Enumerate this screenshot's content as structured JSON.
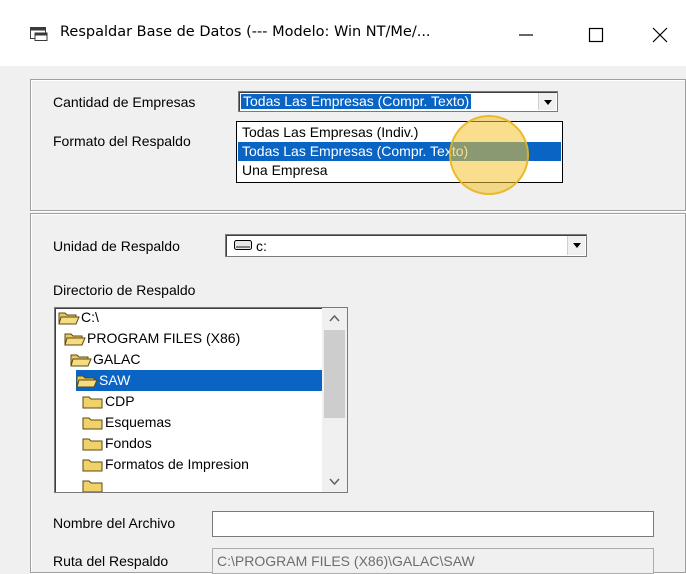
{
  "window": {
    "title": "Respaldar Base de Datos  (--- Modelo: Win NT/Me/...",
    "icon": "window-app-icon",
    "controls": [
      "minimize-icon",
      "maximize-icon",
      "close-icon"
    ]
  },
  "options_group": {
    "cantidad_label": "Cantidad de Empresas",
    "cantidad_value": "Todas Las Empresas (Compr. Texto)",
    "formato_label": "Formato del Respaldo",
    "dropdown_options": [
      "Todas Las Empresas (Indiv.)",
      "Todas Las Empresas (Compr. Texto)",
      "Una Empresa"
    ],
    "selected_option": "Todas Las Empresas (Compr. Texto)"
  },
  "backup_group": {
    "unidad_label": "Unidad de Respaldo",
    "unidad_value": "c:",
    "directorio_label": "Directorio de Respaldo",
    "directories": [
      {
        "name": "C:\\",
        "icon": "open-folder-icon"
      },
      {
        "name": "PROGRAM FILES (X86)",
        "icon": "open-folder-icon"
      },
      {
        "name": "GALAC",
        "icon": "open-folder-icon"
      },
      {
        "name": "SAW",
        "icon": "open-folder-icon",
        "selected": true
      },
      {
        "name": "CDP",
        "icon": "folder-icon"
      },
      {
        "name": "Esquemas",
        "icon": "folder-icon"
      },
      {
        "name": "Fondos",
        "icon": "folder-icon"
      },
      {
        "name": "Formatos de Impresion",
        "icon": "folder-icon"
      }
    ],
    "nombre_label": "Nombre del Archivo",
    "nombre_value": "",
    "ruta_label": "Ruta del Respaldo",
    "ruta_value": "C:\\PROGRAM FILES (X86)\\GALAC\\SAW"
  },
  "colors": {
    "selection": "#0a64c4",
    "cursor_highlight": "#f4c430",
    "window_bg": "#f0f0f0"
  }
}
